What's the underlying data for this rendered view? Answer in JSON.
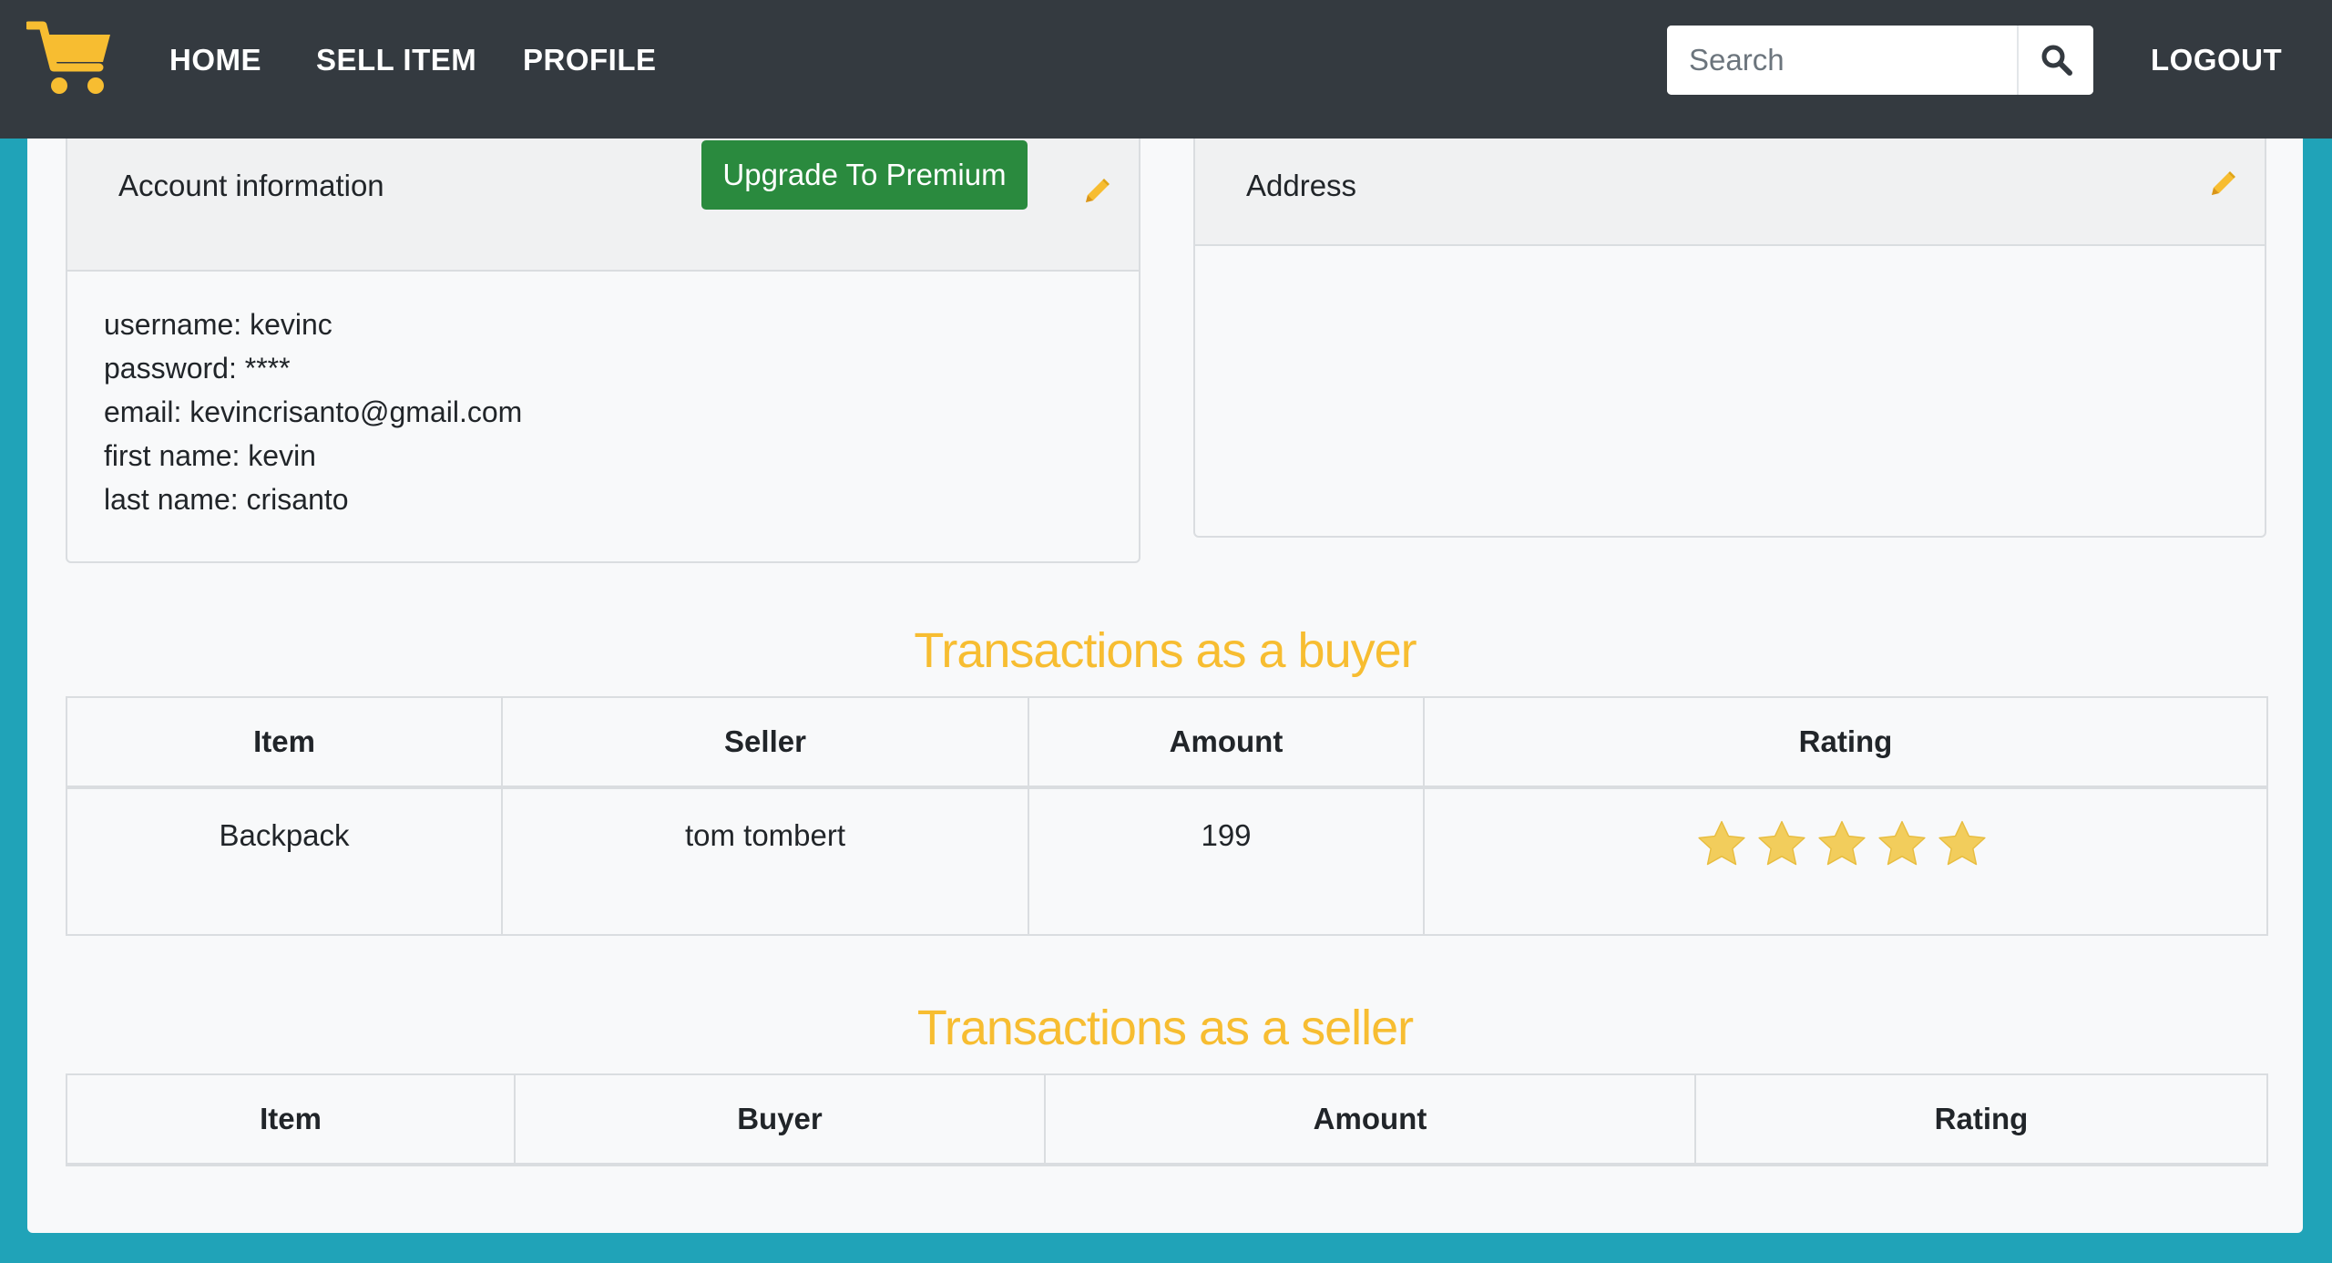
{
  "nav": {
    "logo_icon": "shopping-cart-icon",
    "links": [
      "HOME",
      "SELL ITEM",
      "PROFILE"
    ],
    "search_placeholder": "Search",
    "search_icon": "search-icon",
    "logout": "LOGOUT"
  },
  "account": {
    "title": "Account information",
    "upgrade_label": "Upgrade To Premium",
    "edit_icon": "pencil-icon",
    "lines": [
      "username: kevinc",
      "password: ****",
      "email: kevincrisanto@gmail.com",
      "first name: kevin",
      "last name: crisanto"
    ]
  },
  "address": {
    "title": "Address",
    "edit_icon": "pencil-icon"
  },
  "buyer": {
    "title": "Transactions as a buyer",
    "headers": [
      "Item",
      "Seller",
      "Amount",
      "Rating"
    ],
    "rows": [
      {
        "item": "Backpack",
        "seller": "tom tombert",
        "amount": "199",
        "rating": 5,
        "rating_max": 5
      }
    ]
  },
  "seller": {
    "title": "Transactions as a seller",
    "headers": [
      "Item",
      "Buyer",
      "Amount",
      "Rating"
    ],
    "rows": []
  },
  "colors": {
    "navbar": "#343a40",
    "page_background": "#20a3b8",
    "accent_yellow": "#f7bd31",
    "premium_green": "#2a8a3e",
    "star_fill": "#f2cd5c"
  }
}
